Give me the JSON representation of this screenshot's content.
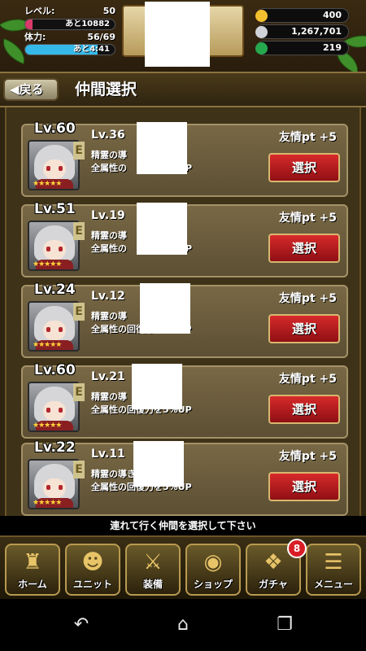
{
  "status": {
    "level_label": "レベル:",
    "level_value": "50",
    "exp_text": "あと10882",
    "exp_fraction": 0.08,
    "stamina_label": "体力:",
    "stamina_value": "56/69",
    "stamina_timer": "あと4:41",
    "stamina_fraction": 0.81,
    "gold": "400",
    "coins": "1,267,701",
    "gems": "219",
    "colors": {
      "gold": "#f2c02e",
      "coins": "#cfd3d9",
      "gems": "#27a84f",
      "exp_bar": "#d83a6a",
      "stamina_bar": "#35b9e8"
    }
  },
  "header": {
    "back_label": "◀戻る",
    "title": "仲間選択"
  },
  "friends": [
    {
      "big_level": "Lv.60",
      "level": "Lv.36",
      "friend_pt": "友情pt +5",
      "skill_name": "精霊の導",
      "skill_desc": "全属性の",
      "skill_desc_tail": "%UP",
      "button": "選択"
    },
    {
      "big_level": "Lv.51",
      "level": "Lv.19",
      "friend_pt": "友情pt +5",
      "skill_name": "精霊の導",
      "skill_desc": "全属性の",
      "skill_desc_tail": "%UP",
      "button": "選択"
    },
    {
      "big_level": "Lv.24",
      "level": "Lv.12",
      "friend_pt": "友情pt +5",
      "skill_name": "精霊の導",
      "skill_desc": "全属性の回復力を5%UP",
      "skill_desc_tail": "",
      "button": "選択"
    },
    {
      "big_level": "Lv.60",
      "level": "Lv.21",
      "friend_pt": "友情pt +5",
      "skill_name": "精霊の導",
      "skill_desc": "全属性の回復力を5%UP",
      "skill_desc_tail": "",
      "button": "選択"
    },
    {
      "big_level": "Lv.22",
      "level": "Lv.11",
      "friend_pt": "友情pt +5",
      "skill_name": "精霊の導き",
      "skill_desc": "全属性の回復力を5%UP",
      "skill_desc_tail": "",
      "button": "選択"
    }
  ],
  "instruction": "連れて行く仲間を選択して下さい",
  "nav": {
    "home": "ホーム",
    "unit": "ユニット",
    "equip": "装備",
    "shop": "ショップ",
    "gacha": "ガチャ",
    "menu": "メニュー",
    "gacha_badge": "8"
  },
  "android": {
    "back_icon": "back-icon",
    "home_icon": "home-icon",
    "recents_icon": "recents-icon"
  }
}
